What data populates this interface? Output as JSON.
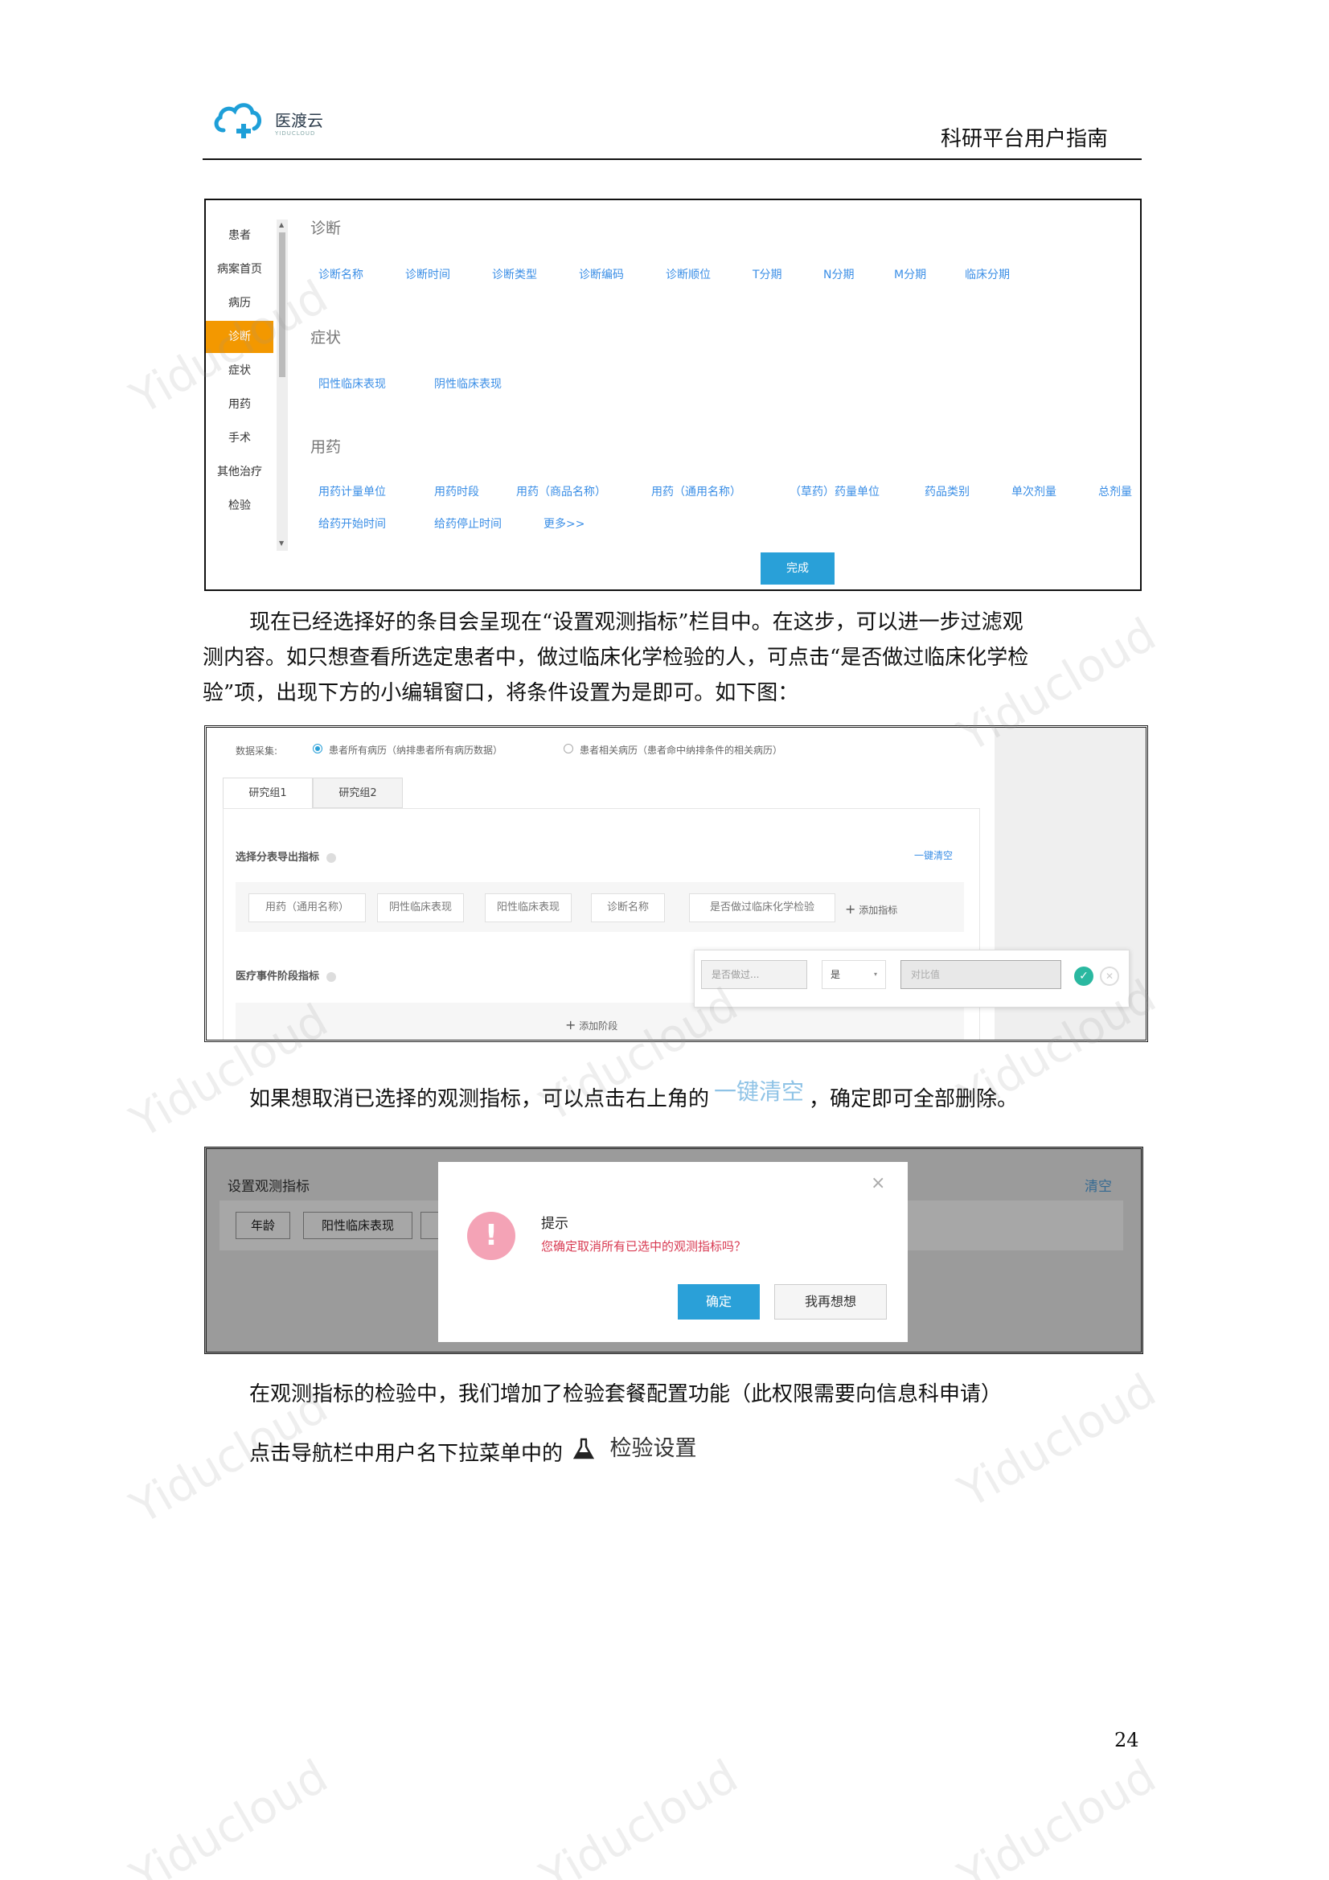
{
  "header": {
    "logo_name": "医渡云",
    "logo_sub": "YIDUCLOUD",
    "doc_title": "科研平台用户指南"
  },
  "shot1": {
    "nav_items": [
      "患者",
      "病案首页",
      "病历",
      "诊断",
      "症状",
      "用药",
      "手术",
      "其他治疗",
      "检验"
    ],
    "active_index": 3,
    "sections": [
      {
        "title": "诊断",
        "links": [
          "诊断名称",
          "诊断时间",
          "诊断类型",
          "诊断编码",
          "诊断顺位",
          "T分期",
          "N分期",
          "M分期",
          "临床分期"
        ]
      },
      {
        "title": "症状",
        "links": [
          "阳性临床表现",
          "阴性临床表现"
        ]
      },
      {
        "title": "用药",
        "links": [
          "用药计量单位",
          "用药时段",
          "用药（商品名称）",
          "用药（通用名称）",
          "（草药）药量单位",
          "药品类别",
          "单次剂量",
          "总剂量"
        ],
        "links2": [
          "给药开始时间",
          "给药停止时间",
          "更多>>"
        ]
      }
    ],
    "done_button": "完成"
  },
  "para1": {
    "line1": "现在已经选择好的条目会呈现在“设置观测指标”栏目中。在这步，可以进一步过滤观",
    "line2": "测内容。如只想查看所选定患者中，做过临床化学检验的人，可点击“是否做过临床化学检",
    "line3": "验”项，出现下方的小编辑窗口，将条件设置为是即可。如下图："
  },
  "shot2": {
    "data_label": "数据采集:",
    "radio1": "患者所有病历（纳排患者所有病历数据）",
    "radio2": "患者相关病历（患者命中纳排条件的相关病历）",
    "tabs": [
      "研究组1",
      "研究组2"
    ],
    "section1_title": "选择分表导出指标",
    "clear_all": "一键清空",
    "chips": [
      "用药（通用名称）",
      "阴性临床表现",
      "阳性临床表现",
      "诊断名称",
      "是否做过临床化学检验"
    ],
    "add_indicator": "添加指标",
    "section2_title": "医疗事件阶段指标",
    "add_stage": "添加阶段",
    "editor_field": "是否做过...",
    "editor_value": "是",
    "editor_compare_placeholder": "对比值"
  },
  "para2": {
    "before": "如果想取消已选择的观测指标，可以点击右上角的",
    "inline": "一键清空",
    "after": "，确定即可全部删除。"
  },
  "shot3": {
    "panel_title": "设置观测指标",
    "panel_clear": "清空",
    "chips": [
      "年龄",
      "阳性临床表现"
    ],
    "dialog_title": "提示",
    "dialog_message": "您确定取消所有已选中的观测指标吗？",
    "confirm": "确定",
    "cancel": "我再想想"
  },
  "para3": {
    "line1": "在观测指标的检验中，我们增加了检验套餐配置功能（此权限需要向信息科申请）",
    "line2": "点击导航栏中用户名下拉菜单中的",
    "inline_menu": "检验设置"
  },
  "page_number": "24",
  "watermark_text": "Yiducloud"
}
